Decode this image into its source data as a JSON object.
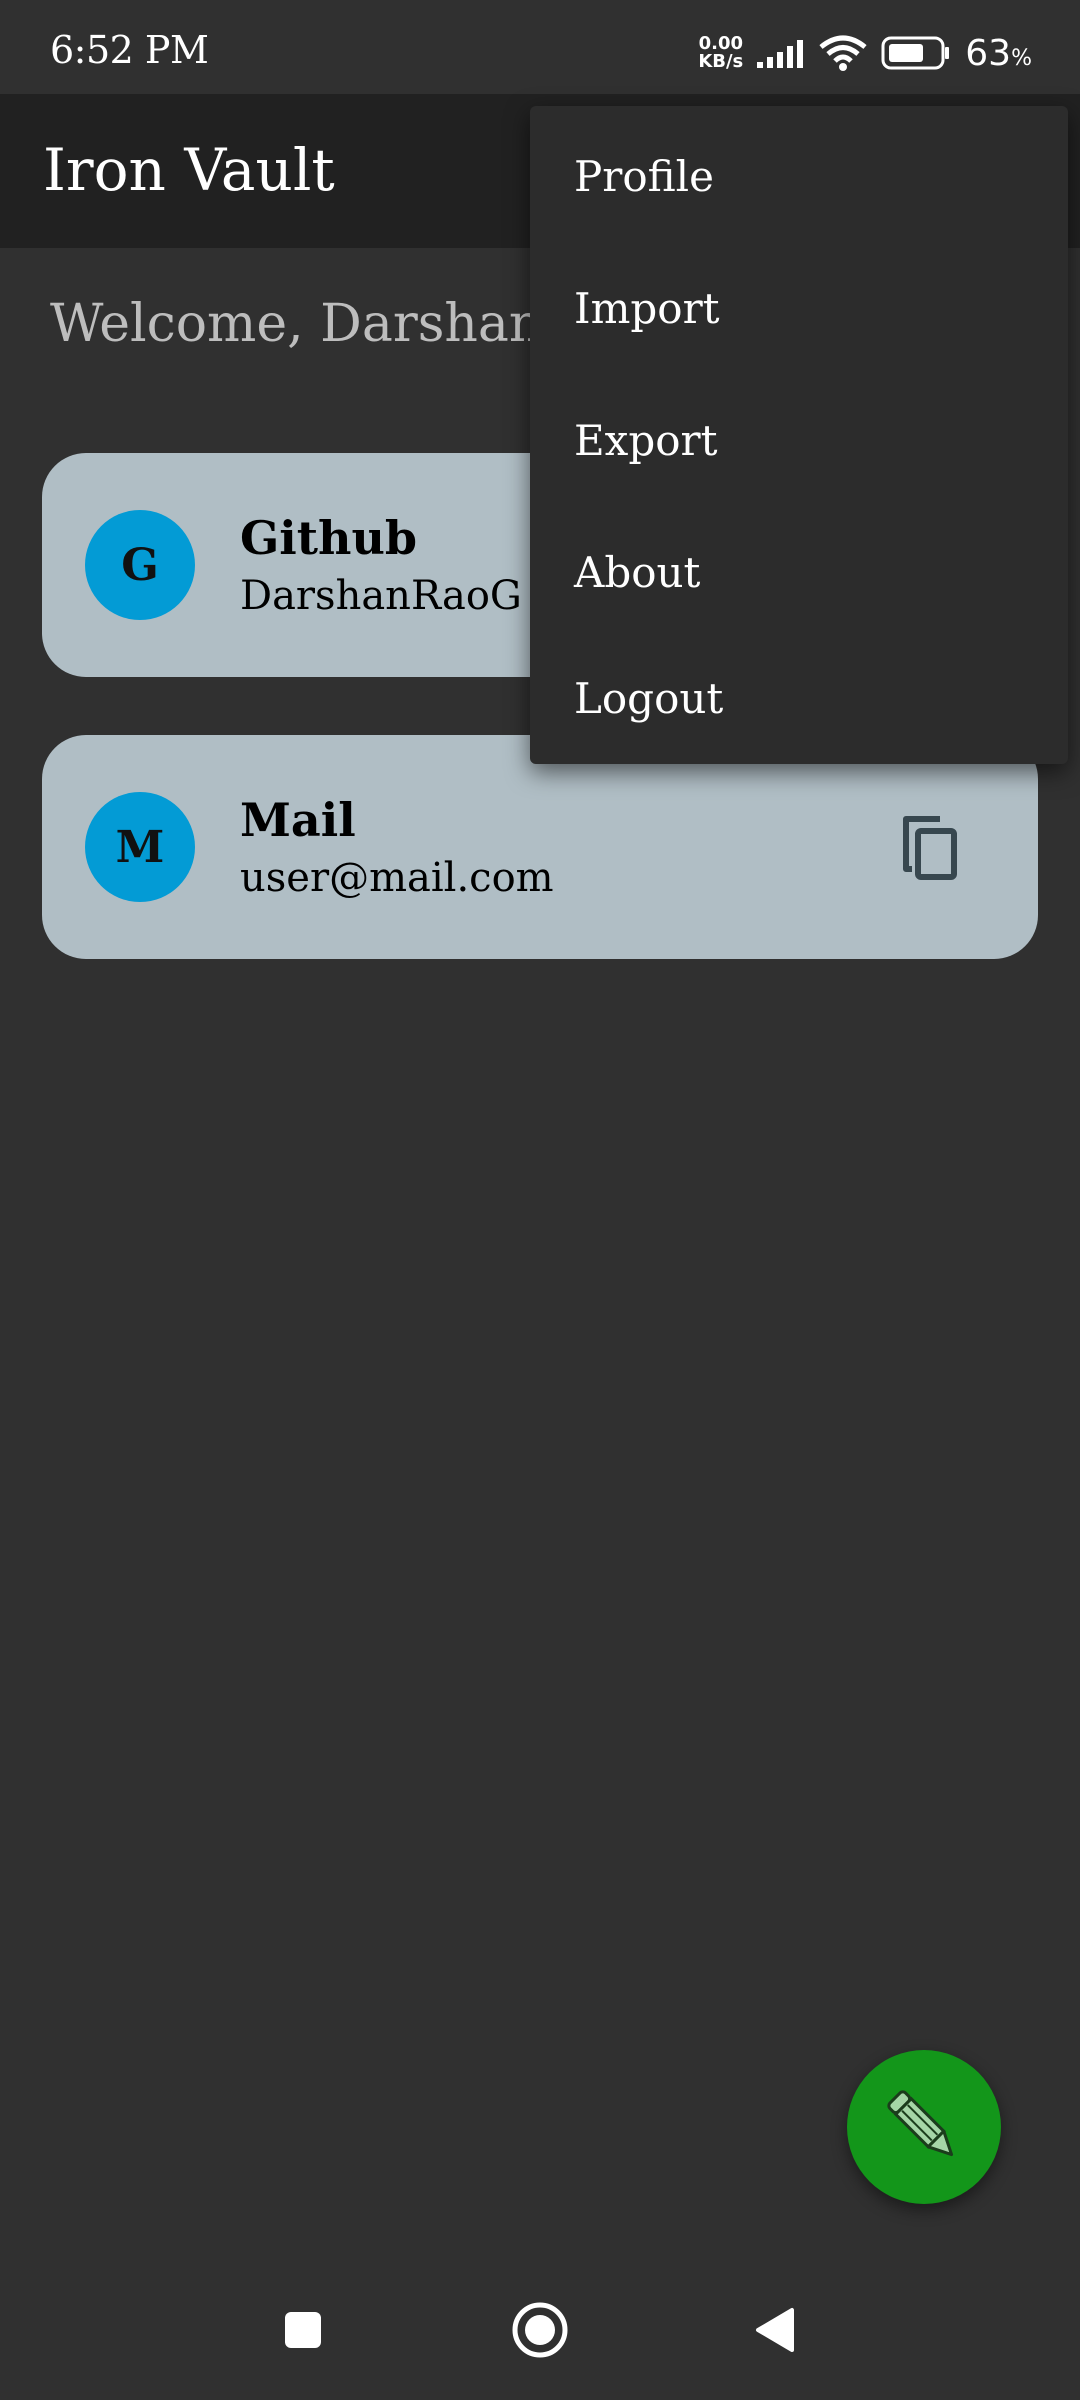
{
  "status_bar": {
    "time": "6:52 PM",
    "net_speed_value": "0.00",
    "net_speed_unit": "KB/s",
    "battery_percent": "63",
    "battery_unit": "%",
    "icons": [
      "signal-icon",
      "wifi-icon",
      "battery-icon"
    ]
  },
  "app_bar": {
    "title": "Iron Vault"
  },
  "welcome": {
    "text": "Welcome, Darshan!"
  },
  "entries": [
    {
      "initial": "G",
      "title": "Github",
      "subtitle": "DarshanRaoG"
    },
    {
      "initial": "M",
      "title": "Mail",
      "subtitle": "user@mail.com",
      "action_icon": "copy-icon"
    }
  ],
  "menu": {
    "items": [
      {
        "label": "Profile"
      },
      {
        "label": "Import"
      },
      {
        "label": "Export"
      },
      {
        "label": "About"
      },
      {
        "label": "Logout"
      }
    ]
  },
  "fab": {
    "icon": "pencil-icon"
  },
  "navigation": {
    "buttons": [
      "recents-square-icon",
      "home-circle-icon",
      "back-triangle-icon"
    ]
  },
  "colors": {
    "background": "#303030",
    "app_bar": "#212121",
    "card": "#b0bec5",
    "avatar": "#039bd5",
    "fab": "#13961a",
    "menu": "#2c2c2c"
  }
}
